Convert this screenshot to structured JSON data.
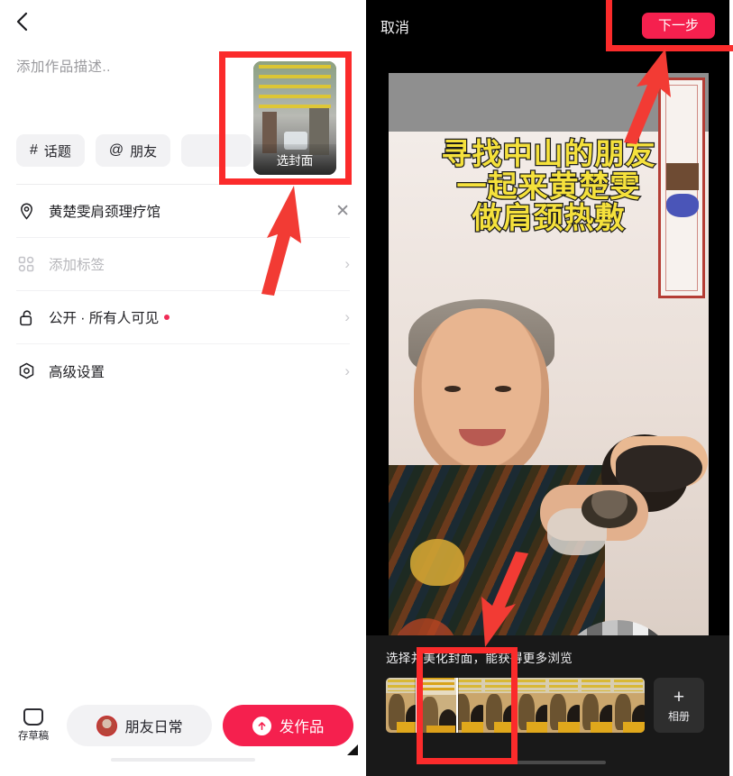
{
  "left": {
    "back_icon": "chevron-left-icon",
    "description": {
      "placeholder": "添加作品描述.."
    },
    "chips": [
      {
        "symbol": "#",
        "label": "话题"
      },
      {
        "symbol": "@",
        "label": "朋友"
      },
      {
        "symbol": "",
        "label": ""
      }
    ],
    "cover_card": {
      "label": "选封面"
    },
    "options": [
      {
        "icon": "location-pin-icon",
        "label": "黄楚雯肩颈理疗馆",
        "muted": false,
        "trailing": "close",
        "dot": false
      },
      {
        "icon": "tag-grid-icon",
        "label": "添加标签",
        "muted": true,
        "trailing": "chevron",
        "dot": false
      },
      {
        "icon": "unlock-icon",
        "label": "公开 · 所有人可见",
        "muted": false,
        "trailing": "chevron",
        "dot": true
      },
      {
        "icon": "advanced-settings-icon",
        "label": "高级设置",
        "muted": false,
        "trailing": "chevron",
        "dot": false
      }
    ],
    "bottom": {
      "draft_label": "存草稿",
      "friend_label": "朋友日常",
      "publish_label": "发作品"
    }
  },
  "right": {
    "cancel_label": "取消",
    "next_label": "下一步",
    "video_overlay_lines": [
      "寻找中山的朋友",
      "一起来黄楚雯",
      "做肩颈热敷"
    ],
    "cover_hint": "选择并美化封面，能获得更多浏览",
    "album_label": "相册",
    "album_plus": "+"
  },
  "colors": {
    "accent_pink": "#f5204e",
    "annotation_red": "#fb2b2b",
    "overlay_yellow": "#f5e13c",
    "dot_red": "#f02c56"
  }
}
